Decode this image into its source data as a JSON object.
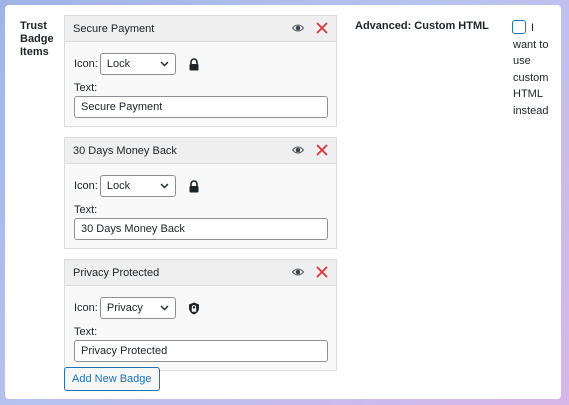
{
  "field_label": "Trust Badge Items",
  "badges": [
    {
      "title": "Secure Payment",
      "icon_label": "Icon:",
      "icon_value": "Lock",
      "icon_name": "lock-icon",
      "text_label": "Text:",
      "text_value": "Secure Payment"
    },
    {
      "title": "30 Days Money Back",
      "icon_label": "Icon:",
      "icon_value": "Lock",
      "icon_name": "lock-icon",
      "text_label": "Text:",
      "text_value": "30 Days Money Back"
    },
    {
      "title": "Privacy Protected",
      "icon_label": "Icon:",
      "icon_value": "Privacy",
      "icon_name": "privacy-shield-icon",
      "text_label": "Text:",
      "text_value": "Privacy Protected"
    }
  ],
  "add_button_label": "Add New Badge",
  "advanced": {
    "label": "Advanced: Custom HTML",
    "checkbox_checked": false,
    "checkbox_text": "I want to use custom HTML instead"
  },
  "colors": {
    "accent": "#2271b1",
    "remove": "#d63638",
    "header_bg": "#efefef",
    "card_bg": "#f9f9f9"
  }
}
